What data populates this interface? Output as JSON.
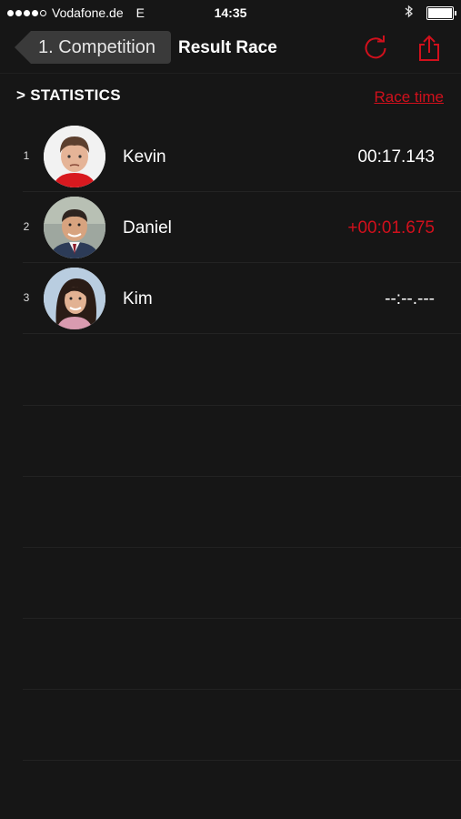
{
  "status_bar": {
    "carrier": "Vodafone.de",
    "network": "E",
    "time": "14:35"
  },
  "nav": {
    "back_label": "1. Competition",
    "title": "Result Race"
  },
  "section": {
    "title": "> STATISTICS",
    "sort_link": "Race time"
  },
  "results": [
    {
      "rank": "1",
      "name": "Kevin",
      "time": "00:17.143"
    },
    {
      "rank": "2",
      "name": "Daniel",
      "time": "+00:01.675"
    },
    {
      "rank": "3",
      "name": "Kim",
      "time": "--:--.---"
    }
  ],
  "colors": {
    "accent": "#d1101c",
    "background": "#161616"
  }
}
